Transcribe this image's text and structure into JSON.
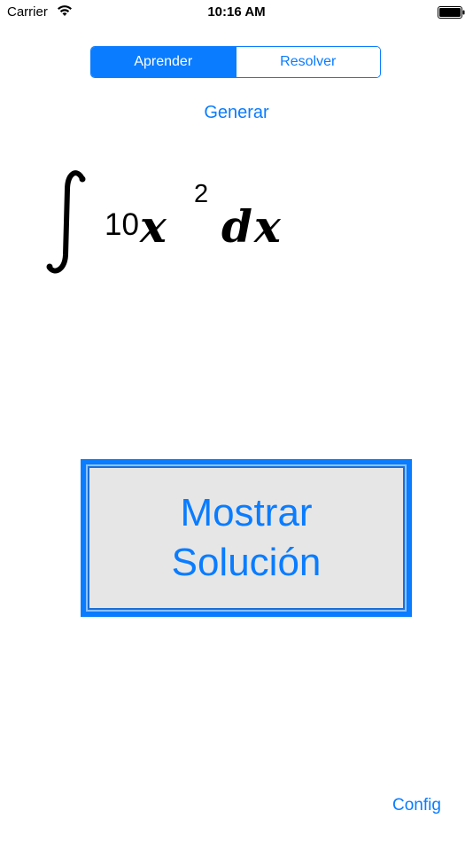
{
  "status_bar": {
    "carrier": "Carrier",
    "time": "10:16 AM"
  },
  "segmented_control": {
    "items": [
      {
        "label": "Aprender",
        "selected": true
      },
      {
        "label": "Resolver",
        "selected": false
      }
    ]
  },
  "generate_label": "Generar",
  "formula": {
    "coefficient": "10",
    "variable": "x",
    "exponent": "2",
    "differential": "dx"
  },
  "solution_button": {
    "line1": "Mostrar",
    "line2": "Solución"
  },
  "config_label": "Config",
  "colors": {
    "accent": "#0a7cff",
    "button_fill": "#e6e6e6"
  }
}
